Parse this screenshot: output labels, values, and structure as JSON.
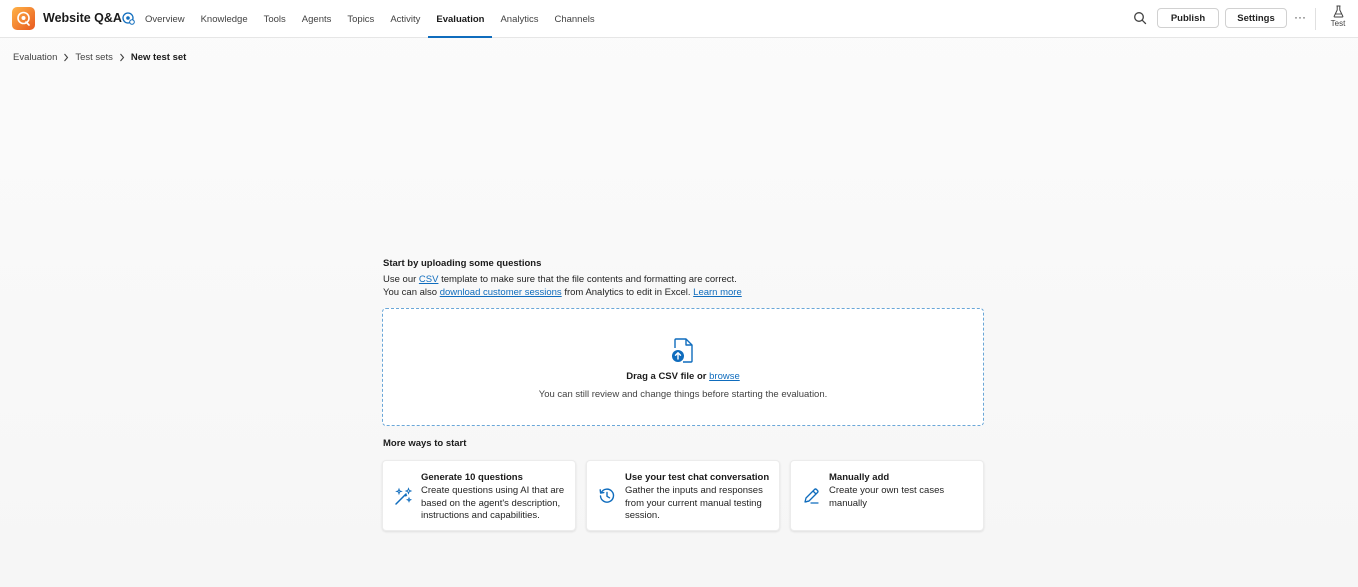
{
  "app": {
    "title": "Website Q&A"
  },
  "nav": {
    "tabs": [
      {
        "label": "Overview"
      },
      {
        "label": "Knowledge"
      },
      {
        "label": "Tools"
      },
      {
        "label": "Agents"
      },
      {
        "label": "Topics"
      },
      {
        "label": "Activity"
      },
      {
        "label": "Evaluation",
        "active": true
      },
      {
        "label": "Analytics"
      },
      {
        "label": "Channels"
      }
    ]
  },
  "toolbar": {
    "publish_label": "Publish",
    "settings_label": "Settings",
    "more_label": "···",
    "test_label": "Test"
  },
  "breadcrumb": {
    "items": [
      "Evaluation",
      "Test sets",
      "New test set"
    ]
  },
  "intro": {
    "heading": "Start by uploading some questions",
    "line1_prefix": "Use our ",
    "line1_link": "CSV",
    "line1_suffix": " template to make sure that the file contents and formatting are correct.",
    "line2_prefix": "You can also ",
    "line2_link": "download customer sessions",
    "line2_middle": " from Analytics to edit in Excel. ",
    "line2_learn_more": "Learn more"
  },
  "dropzone": {
    "title_prefix": "Drag a CSV file or ",
    "browse_link": "browse",
    "subtitle": "You can still review and change things before starting the evaluation."
  },
  "more_ways": {
    "heading": "More ways to start",
    "cards": [
      {
        "title": "Generate 10 questions",
        "description": "Create questions using AI that are based on the agent's description, instructions and capabilities.",
        "icon": "magic-wand-icon"
      },
      {
        "title": "Use your test chat conversation",
        "description": "Gather the inputs and responses from your current manual testing session.",
        "icon": "history-icon"
      },
      {
        "title": "Manually add",
        "description": "Create your own test cases manually",
        "icon": "pen-icon"
      }
    ]
  },
  "colors": {
    "accent": "#0f6cbd",
    "logo_gradient_start": "#ffb347",
    "logo_gradient_end": "#e8591f"
  }
}
